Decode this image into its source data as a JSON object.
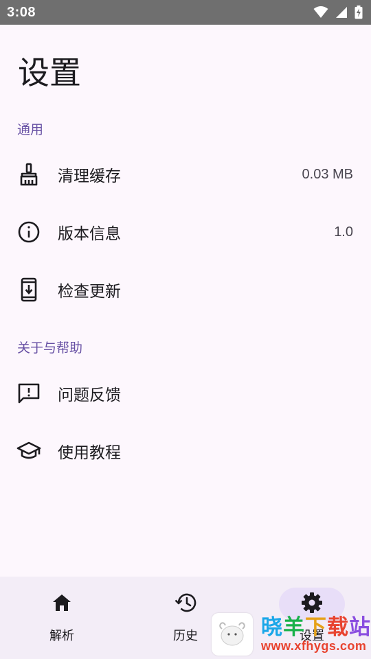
{
  "status_bar": {
    "time": "3:08",
    "icons": [
      "wifi-icon",
      "signal-icon",
      "battery-charging-icon"
    ]
  },
  "page": {
    "title": "设置"
  },
  "sections": [
    {
      "header": "通用",
      "items": [
        {
          "icon": "broom-icon",
          "label": "清理缓存",
          "value": "0.03 MB"
        },
        {
          "icon": "info-icon",
          "label": "版本信息",
          "value": "1.0"
        },
        {
          "icon": "phone-download-icon",
          "label": "检查更新",
          "value": ""
        }
      ]
    },
    {
      "header": "关于与帮助",
      "items": [
        {
          "icon": "feedback-icon",
          "label": "问题反馈",
          "value": ""
        },
        {
          "icon": "school-icon",
          "label": "使用教程",
          "value": ""
        }
      ]
    }
  ],
  "bottom_nav": {
    "items": [
      {
        "icon": "home-icon",
        "label": "解析",
        "active": false
      },
      {
        "icon": "history-icon",
        "label": "历史",
        "active": false
      },
      {
        "icon": "settings-gear-icon",
        "label": "设置",
        "active": true
      }
    ]
  },
  "watermark": {
    "title_chars": [
      "晓",
      "羊",
      "下",
      "载",
      "站"
    ],
    "url": "www.xfhygs.com"
  },
  "colors": {
    "background": "#fdf7fd",
    "accent": "#6750a4",
    "nav_background": "#f3edf7",
    "nav_active_pill": "#e8def8",
    "status_bar": "#6f6f6f"
  }
}
